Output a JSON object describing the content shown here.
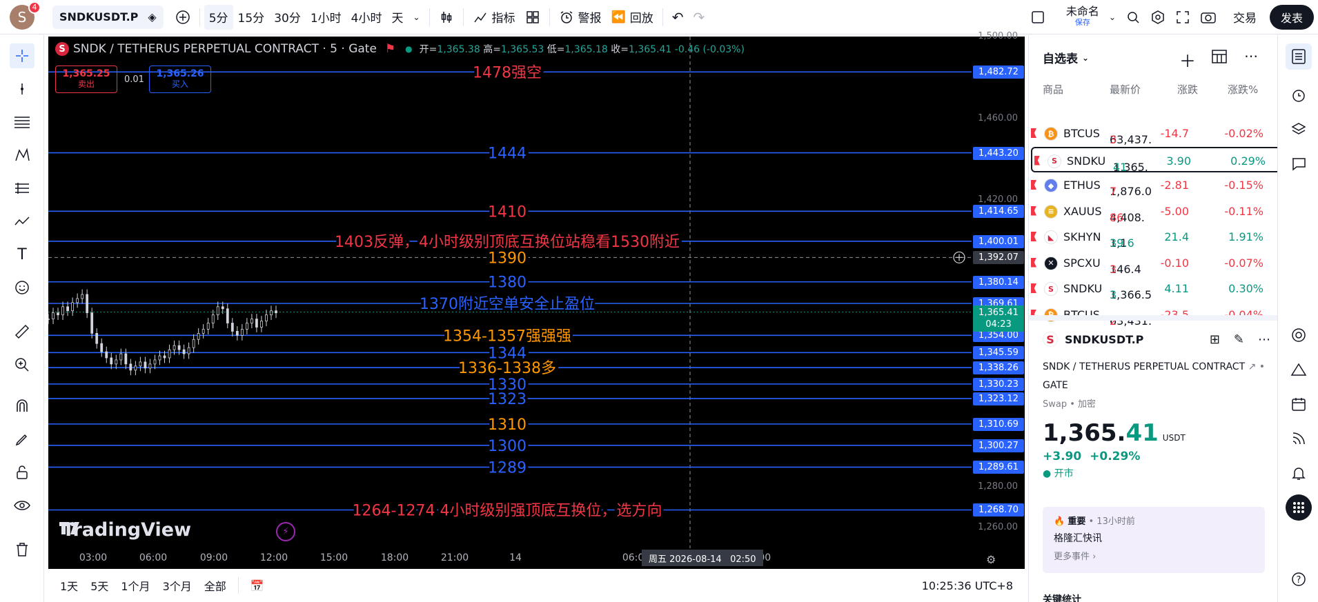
{
  "topbar": {
    "avatar_letter": "S",
    "avatar_badge": "4",
    "symbol": "SNDKUSDT.P",
    "intervals": [
      "5分",
      "15分",
      "30分",
      "1小时",
      "4小时",
      "天"
    ],
    "active_interval": "5分",
    "indicators_label": "指标",
    "alert_label": "警报",
    "replay_label": "回放",
    "layout_name": "未命名",
    "layout_saved": "保存",
    "trade_label": "交易",
    "publish_label": "发表"
  },
  "chart": {
    "title": "SNDK / TETHERUS PERPETUAL CONTRACT · 5 · Gate",
    "ohlc": {
      "open_label": "开",
      "open": "1,365.38",
      "high_label": "高",
      "high": "1,365.53",
      "low_label": "低",
      "low": "1,365.18",
      "close_label": "收",
      "close": "1,365.41",
      "change": "-0.46 (-0.03%)"
    },
    "sell": {
      "price": "1,365.25",
      "label": "卖出"
    },
    "spread": "0.01",
    "buy": {
      "price": "1,365.26",
      "label": "买入"
    },
    "logo_text": "TradingView",
    "colors": {
      "blue_line": "#2962ff",
      "red_text": "#f23645",
      "orange_text": "#ff9800",
      "blue_text": "#2962ff",
      "candle": "#d1d4dc"
    }
  },
  "chart_data": {
    "type": "line",
    "symbol": "SNDKUSDT.P",
    "ylim": [
      1250,
      1500
    ],
    "price_ticks": [
      "1,500.00",
      "1,460.00",
      "1,420.00",
      "1,280.00",
      "1,260.00"
    ],
    "time_ticks": [
      "03:00",
      "06:00",
      "09:00",
      "12:00",
      "15:00",
      "18:00",
      "21:00",
      "14",
      "06:00",
      "09:00",
      "12:00"
    ],
    "crosshair_time": "周五 2026-08-14   02:50",
    "crosshair_price": "1,392.07",
    "last_price": "1,365.41",
    "countdown": "04:23",
    "horizontal_levels": [
      {
        "price": 1482.72,
        "label": "1,482.72",
        "note": "1478强空",
        "color": "#f23645"
      },
      {
        "price": 1443.2,
        "label": "1,443.20",
        "note": "1444",
        "color": "#2962ff"
      },
      {
        "price": 1414.65,
        "label": "1,414.65",
        "note": "1410",
        "color": "#f23645"
      },
      {
        "price": 1400.01,
        "label": "1,400.01",
        "note": "1403反弹，4小时级别顶底互换位站稳看1530附近",
        "color": "#f23645"
      },
      {
        "price": 1380.14,
        "label": "1,380.14",
        "note": "1380",
        "color": "#2962ff"
      },
      {
        "price": 1369.61,
        "label": "1,369.61",
        "note": "1370附近空单安全止盈位",
        "color": "#2962ff"
      },
      {
        "price": 1354.0,
        "label": "1,354.00",
        "note": "1354-1357强强强",
        "color": "#ff9800"
      },
      {
        "price": 1345.59,
        "label": "1,345.59",
        "note": "1344",
        "color": "#2962ff"
      },
      {
        "price": 1338.26,
        "label": "1,338.26",
        "note": "1336-1338多",
        "color": "#ff9800"
      },
      {
        "price": 1330.23,
        "label": "1,330.23",
        "note": "1330",
        "color": "#2962ff"
      },
      {
        "price": 1323.12,
        "label": "1,323.12",
        "note": "1323",
        "color": "#2962ff"
      },
      {
        "price": 1310.69,
        "label": "1,310.69",
        "note": "1310",
        "color": "#ff9800"
      },
      {
        "price": 1300.27,
        "label": "1,300.27",
        "note": "1300",
        "color": "#2962ff"
      },
      {
        "price": 1289.61,
        "label": "1,289.61",
        "note": "1289",
        "color": "#2962ff"
      },
      {
        "price": 1268.7,
        "label": "1,268.70",
        "note": "1264-1274  4小时级别强顶底互换位，选方向",
        "color": "#f23645"
      }
    ],
    "extra_note": {
      "text": "1390",
      "price": 1392.07,
      "color": "#ff9800"
    },
    "price_series": [
      1362,
      1365,
      1364,
      1368,
      1366,
      1370,
      1372,
      1374,
      1365,
      1355,
      1350,
      1346,
      1343,
      1340,
      1342,
      1345,
      1340,
      1337,
      1339,
      1341,
      1338,
      1340,
      1342,
      1344,
      1343,
      1347,
      1349,
      1347,
      1345,
      1348,
      1352,
      1355,
      1357,
      1360,
      1364,
      1368,
      1367,
      1360,
      1356,
      1354,
      1357,
      1360,
      1362,
      1358,
      1361,
      1364,
      1366,
      1365
    ]
  },
  "bottombar": {
    "ranges": [
      "1天",
      "5天",
      "1个月",
      "3个月",
      "全部"
    ],
    "clock": "10:25:36 UTC+8"
  },
  "watchlist": {
    "title": "自选表",
    "columns": [
      "商品",
      "最新价",
      "涨跌",
      "涨跌%"
    ],
    "rows": [
      {
        "symbol": "BTCUS",
        "price_main": "63,437.",
        "price_tail": "3",
        "change": "-14.7",
        "pct": "-0.02%",
        "dir": "neg",
        "coin_color": "#f7931a",
        "coin_glyph": "₿"
      },
      {
        "symbol": "SNDKU",
        "price_main": "1,365.",
        "price_tail": "41",
        "change": "3.90",
        "pct": "0.29%",
        "dir": "pos",
        "coin_color": "#ffffff",
        "coin_glyph": "S",
        "selected": true
      },
      {
        "symbol": "ETHUS",
        "price_main": "1,876.0",
        "price_tail": "7",
        "change": "-2.81",
        "pct": "-0.15%",
        "dir": "neg",
        "coin_color": "#627eea",
        "coin_glyph": "◆"
      },
      {
        "symbol": "XAUUS",
        "price_main": "4,408.",
        "price_tail": "86",
        "change": "-5.00",
        "pct": "-0.11%",
        "dir": "neg",
        "coin_color": "#e6b422",
        "coin_glyph": "≡"
      },
      {
        "symbol": "SKHYN",
        "price_main": "1,1",
        "price_tail": "39.6",
        "change": "21.4",
        "pct": "1.91%",
        "dir": "pos",
        "coin_color": "#ffffff",
        "coin_glyph": "◣"
      },
      {
        "symbol": "SPCXU",
        "price_main": "146.4",
        "price_tail": "3",
        "change": "-0.10",
        "pct": "-0.07%",
        "dir": "neg",
        "coin_color": "#131722",
        "coin_glyph": "✕"
      },
      {
        "symbol": "SNDKU",
        "price_main": "1,366.5",
        "price_tail": "3",
        "change": "4.11",
        "pct": "0.30%",
        "dir": "pos",
        "coin_color": "#ffffff",
        "coin_glyph": "S"
      },
      {
        "symbol": "BTCUS",
        "price_main": "63,431.",
        "price_tail": "2",
        "change": "-23.5",
        "pct": "-0.04%",
        "dir": "neg",
        "coin_color": "#f7931a",
        "coin_glyph": "₿"
      }
    ]
  },
  "detail": {
    "symbol": "SNDKUSDT.P",
    "full_name": "SNDK / TETHERUS PERPETUAL CONTRACT",
    "exchange": "GATE",
    "type": "Swap",
    "category": "加密",
    "price_main": "1,365.",
    "price_tail": "41",
    "currency": "USDT",
    "change": "+3.90",
    "pct": "+0.29%",
    "status": "开市",
    "news_tag": "重要",
    "news_time": "13小时前",
    "news_title": "格隆汇快讯",
    "news_more": "更多事件 ›",
    "key_stats": "关键统计"
  }
}
